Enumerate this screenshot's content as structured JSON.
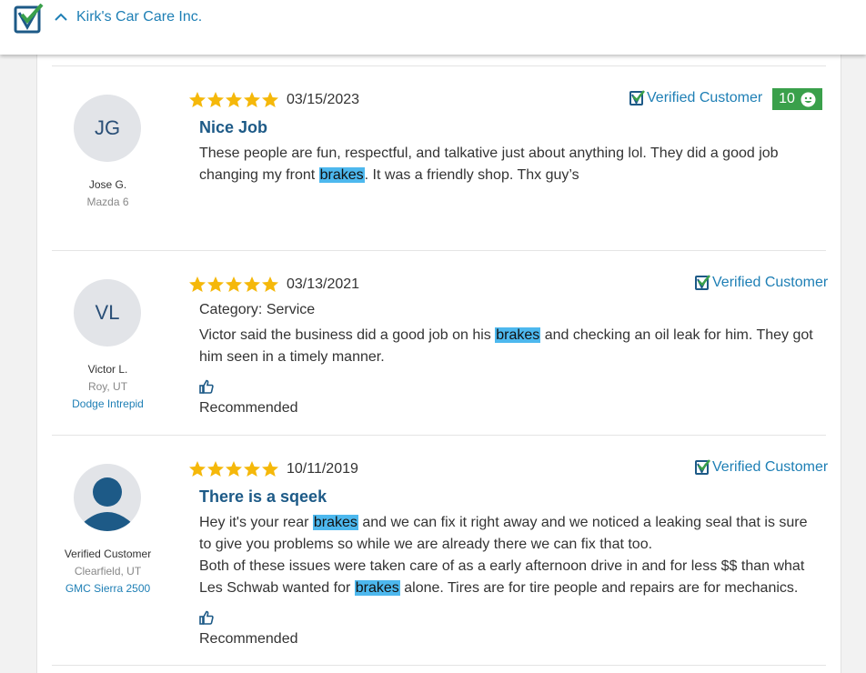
{
  "header": {
    "business_name": "Kirk's Car Care Inc.",
    "logo_icon": "verified-check-logo-icon",
    "collapse_icon": "chevron-up-icon"
  },
  "colors": {
    "star": "#f5b80a",
    "accent": "#1e7fb5",
    "title": "#1d5a87",
    "badge": "#3aa04b",
    "highlight": "#4db8ee"
  },
  "reviews": [
    {
      "initials": "JG",
      "name": "Jose G.",
      "vehicle": "Mazda 6",
      "rating": 5,
      "date": "03/15/2023",
      "verified_label": "Verified Customer",
      "helpful_count": "10",
      "title": "Nice Job",
      "body_1": "These people are fun, respectful, and talkative just about anything lol. They did a good job",
      "body_2a": "changing my front ",
      "keyword": "brakes",
      "body_2b": ". It was a friendly shop. Thx guy’s"
    },
    {
      "initials": "VL",
      "name": "Victor L.",
      "location": "Roy, UT",
      "vehicle": "Dodge Intrepid",
      "rating": 5,
      "date": "03/13/2021",
      "verified_label": "Verified Customer",
      "category": "Category: Service",
      "body_1a": "Victor said the business did a good job on his ",
      "keyword": "brakes",
      "body_1b": " and checking an oil leak for him. They got",
      "body_2": "him seen in a timely manner.",
      "recommended": "Recommended"
    },
    {
      "name": "Verified Customer",
      "location": "Clearfield, UT",
      "vehicle": "GMC Sierra 2500",
      "rating": 5,
      "date": "10/11/2019",
      "verified_label": "Verified Customer",
      "title": "There is a sqeek",
      "body_1a": "Hey it's your rear ",
      "keyword": "brakes",
      "body_1b": " and we can fix it right away and we noticed a leaking seal that is sure",
      "body_2": "to give you problems so while we are already there we can fix that too.",
      "body_3": "Both of these issues were taken care of as a early afternoon drive in and for less $$ than what",
      "body_4a": "Les Schwab wanted for ",
      "body_4b": " alone. Tires are for tire people and repairs are for mechanics.",
      "recommended": "Recommended"
    }
  ]
}
